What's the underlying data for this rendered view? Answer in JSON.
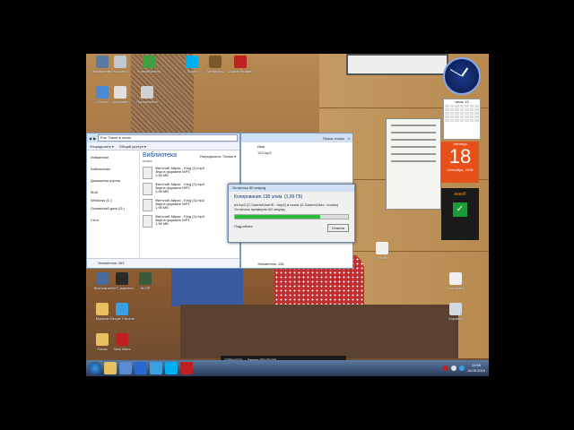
{
  "desktop": {
    "icons_top": [
      {
        "label": "Компьютер",
        "color": "#5a7aa0"
      },
      {
        "label": "Корзина",
        "color": "#c0c8d0"
      },
      {
        "label": "FormatFactory",
        "color": "#40a040"
      },
      {
        "label": "Skype",
        "color": "#00aff0"
      },
      {
        "label": "Антивирус",
        "color": "#7a5a2a"
      },
      {
        "label": "Adobe Reader",
        "color": "#c02020"
      }
    ],
    "icons_row2": [
      {
        "label": "uTorrent",
        "color": "#4a8ad0"
      },
      {
        "label": "Документ",
        "color": "#e0e0e0"
      },
      {
        "label": "Приложение",
        "color": "#d0d0d0"
      }
    ],
    "icons_bottom": [
      {
        "label": "Вконтакте",
        "color": "#4a6a9a"
      },
      {
        "label": "WoT_launcher",
        "color": "#2a2a2a"
      },
      {
        "label": "W-GP",
        "color": "#3a5a3a"
      },
      {
        "label": "Музыка",
        "color": "#e8c060"
      },
      {
        "label": "Google Chrome",
        "color": "#3aa0e0"
      },
      {
        "label": "Папка",
        "color": "#e8c060"
      },
      {
        "label": "Total Video",
        "color": "#c02020"
      }
    ],
    "icons_right": [
      {
        "label": "file.txt",
        "color": "#f0f0f0"
      },
      {
        "label": "document",
        "color": "#f0f0f0"
      },
      {
        "label": "Корзина",
        "color": "#d0d8e0"
      }
    ]
  },
  "gadgets": {
    "calendar_title": "июль 13",
    "date_weekday": "пятница",
    "date_day": "18",
    "date_month": "Сентябрь, 2015",
    "avast_label": "avast!"
  },
  "explorer": {
    "address": "Eon Tracer ▸ music",
    "menu": [
      "Упорядочить ▾",
      "Общий доступ ▾"
    ],
    "sidebar": [
      "Избранное",
      "Библиотеки",
      "Домашняя группа",
      "Мой",
      "Windows (C:)",
      "Локальный диск (D:)",
      "Сеть"
    ],
    "library_title": "Библиотека",
    "library_sub": "music",
    "arrange": "Упорядочить:",
    "arrange_value": "Папка ▾",
    "files": [
      {
        "name": "Финтлаб Айрис - King (1).mp3",
        "type": "Звук в формате MP3",
        "size": "1,95 МБ"
      },
      {
        "name": "Финтлаб Айрис - King (2).mp3",
        "type": "Звук в формате MP3",
        "size": "1,95 МБ"
      },
      {
        "name": "Финтлаб Айрис - King (3).mp3",
        "type": "Звук в формате MP3",
        "size": "1,95 МБ"
      },
      {
        "name": "Финтлаб Айрис - King (4).mp3",
        "type": "Звук в формате MP3",
        "size": "1,95 МБ"
      }
    ],
    "status": "Элементов: 163"
  },
  "window2": {
    "search": "Поиск: music",
    "rows": [
      "Имя",
      "123.mp3"
    ],
    "status": "Элементов: 138"
  },
  "copy_dialog": {
    "title": "Осталось 60 секунд",
    "heading": "Копирование 138 элем. (1,99 ГБ)",
    "from_to": "из mp3 (C:\\Users\\User\\Е...\\mp3) в music (C:\\Users\\User...\\music)",
    "remaining": "Осталось примерно 60 секунд",
    "progress": 0.75,
    "details": "Подробнее",
    "cancel": "Отмена"
  },
  "recorder": {
    "resolution": "1280x1024",
    "record": "Запись [00:03:00]"
  },
  "taskbar": {
    "items": [
      {
        "name": "explorer",
        "color": "#e8c060"
      },
      {
        "name": "media",
        "color": "#5a8ad0"
      },
      {
        "name": "player",
        "color": "#2a6ad0"
      },
      {
        "name": "chrome",
        "color": "#3aa0e0"
      },
      {
        "name": "skype",
        "color": "#00aff0"
      },
      {
        "name": "recorder",
        "color": "#c02020"
      }
    ],
    "time": "14:56",
    "date": "18.09.2015"
  }
}
